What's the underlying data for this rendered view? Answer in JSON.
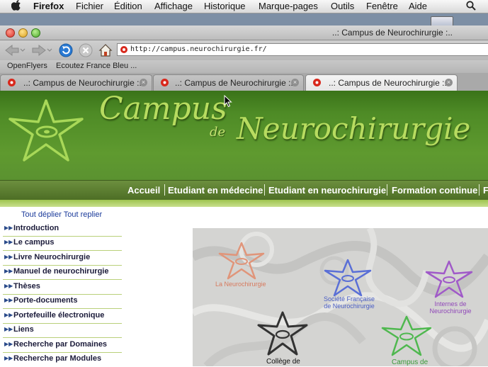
{
  "menubar": {
    "app": "Firefox",
    "items": [
      "Fichier",
      "Édition",
      "Affichage",
      "Historique",
      "Marque-pages",
      "Outils",
      "Fenêtre",
      "Aide"
    ]
  },
  "window": {
    "title": "..: Campus de Neurochirurgie :.."
  },
  "toolbar": {
    "url": "http://campus.neurochirurgie.fr/"
  },
  "bookmarks": [
    "OpenFlyers",
    "Ecoutez France Bleu ..."
  ],
  "tabs": [
    {
      "label": "..: Campus de Neurochirurgie :..",
      "active": false
    },
    {
      "label": "..: Campus de Neurochirurgie :..",
      "active": false
    },
    {
      "label": "..: Campus de Neurochirurgie :..",
      "active": true
    }
  ],
  "banner": {
    "title_line1": "Campus",
    "title_de": "de",
    "title_line2": "Neurochirurgie"
  },
  "site_menu": [
    "Accueil",
    "Etudiant en médecine",
    "Etudiant en neurochirurgie",
    "Formation continue",
    "F"
  ],
  "sidebar": {
    "expand_links": "Tout déplier Tout replier",
    "items": [
      "Introduction",
      "Le campus",
      "Livre Neurochirurgie",
      "Manuel de neurochirurgie",
      "Thèses",
      "Porte-documents",
      "Portefeuille électronique",
      "Liens",
      "Recherche par Domaines",
      "Recherche par Modules"
    ]
  },
  "main_nodes": [
    {
      "label": "La Neurochirurgie",
      "color": "#e0957a"
    },
    {
      "label": "Société Française de Neurochirurgie",
      "color": "#5a6fd6"
    },
    {
      "label": "Internes de Neurochirurgie",
      "color": "#a05ac8"
    },
    {
      "label": "Collège de",
      "color": "#333333"
    },
    {
      "label": "Campus de",
      "color": "#4fb84f"
    }
  ],
  "colors": {
    "banner_green": "#4e8b26",
    "menu_green": "#5b7d30",
    "link_blue": "#1a3a9a"
  }
}
